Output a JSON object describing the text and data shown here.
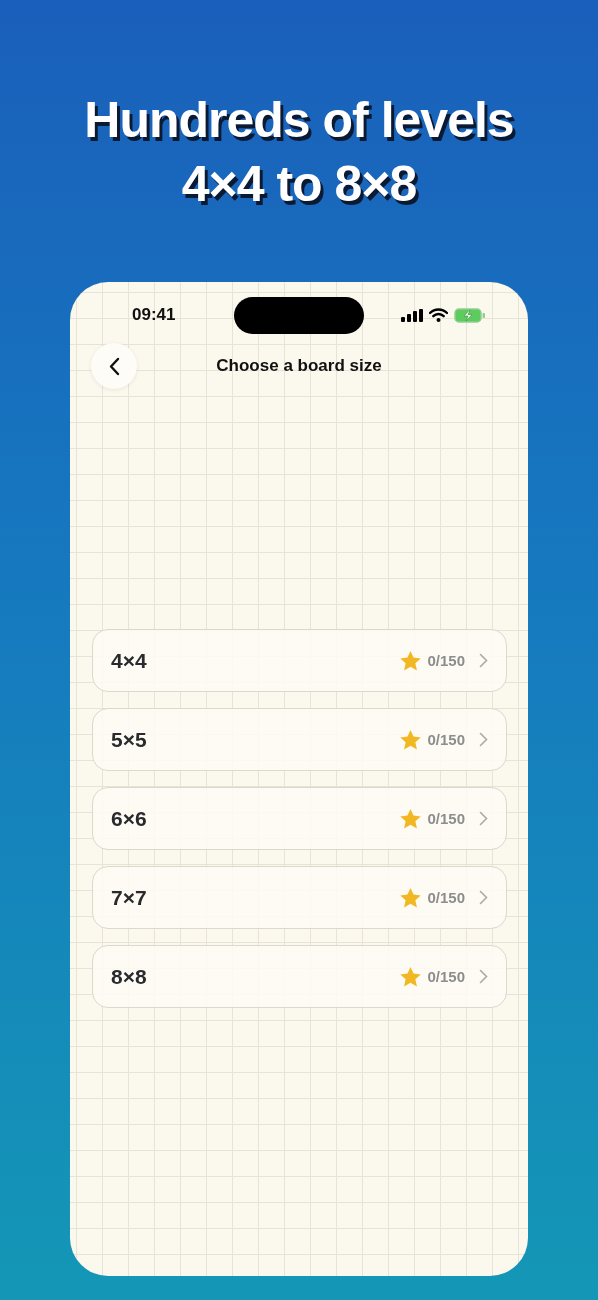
{
  "headline": [
    "Hundreds of levels",
    "4×4 to 8×8"
  ],
  "status_bar": {
    "time": "09:41"
  },
  "header": {
    "title": "Choose a board size"
  },
  "boards": [
    {
      "label": "4×4",
      "progress": "0/150"
    },
    {
      "label": "5×5",
      "progress": "0/150"
    },
    {
      "label": "6×6",
      "progress": "0/150"
    },
    {
      "label": "7×7",
      "progress": "0/150"
    },
    {
      "label": "8×8",
      "progress": "0/150"
    }
  ]
}
